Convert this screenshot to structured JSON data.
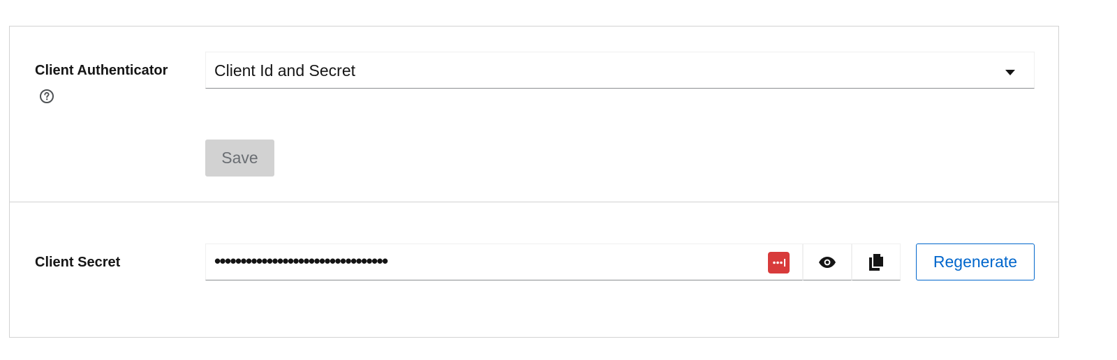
{
  "client_authenticator": {
    "label": "Client Authenticator",
    "help_icon": "question-circle-icon",
    "selected_value": "Client Id and Secret",
    "caret_icon": "caret-down-icon",
    "save_label": "Save"
  },
  "client_secret": {
    "label": "Client Secret",
    "masked_value": "•••••••••••••••••••••••••••••••••",
    "password_manager_icon": "password-manager-icon",
    "show_icon": "eye-icon",
    "copy_icon": "copy-icon",
    "regenerate_label": "Regenerate"
  },
  "colors": {
    "accent": "#0066cc",
    "border": "#d2d2d2",
    "disabled_bg": "#d2d2d2",
    "password_manager": "#d83b3b"
  }
}
